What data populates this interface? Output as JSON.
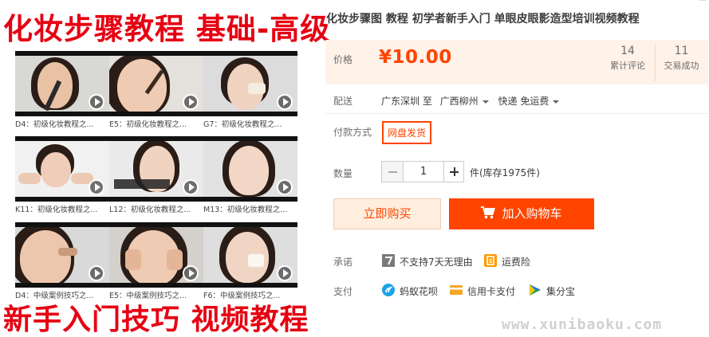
{
  "promo": {
    "headline_top": "化妆步骤教程 基础-高级",
    "headline_bottom": "新手入门技巧 视频教程",
    "thumbnails": [
      {
        "caption": "D4：初级化妆教程之..."
      },
      {
        "caption": "E5：初级化妆教程之..."
      },
      {
        "caption": "G7：初级化妆教程之..."
      },
      {
        "caption": "K11：初级化妆教程之..."
      },
      {
        "caption": "L12：初级化妆教程之..."
      },
      {
        "caption": "M13：初级化妆教程之..."
      },
      {
        "caption": "D4：中级案例技巧之..."
      },
      {
        "caption": "E5：中级案例技巧之..."
      },
      {
        "caption": "F6：中级案例技巧之..."
      }
    ]
  },
  "product": {
    "title": "化妆步骤图 教程 初学者新手入门 单眼皮眼影造型培训视频教程",
    "corner_text": "...",
    "price_label": "价格",
    "price": "¥10.00",
    "reviews_count": "14",
    "reviews_label": "累计评论",
    "sales_count": "11",
    "sales_label": "交易成功",
    "shipping_label": "配送",
    "ship_from": "广东深圳 至",
    "ship_to": "广西柳州",
    "ship_method": "快递 免运费",
    "payment_method_label": "付款方式",
    "payment_method": "网盘发货",
    "quantity_label": "数量",
    "quantity_value": "1",
    "stock_text": "件(库存1975件)",
    "buy_now_label": "立即购买",
    "add_cart_label": "加入购物车",
    "promise_label": "承诺",
    "promise_no_return": "不支持7天无理由",
    "promise_shipping_insurance": "运费险",
    "payment_label": "支付",
    "pay_huabei": "蚂蚁花呗",
    "pay_credit": "信用卡支付",
    "pay_jifenbao": "集分宝"
  },
  "watermark": "www.xunibaoku.com",
  "colors": {
    "accent": "#ff4400",
    "promo_red": "#e60012",
    "price_bg": "#fff2e8"
  }
}
